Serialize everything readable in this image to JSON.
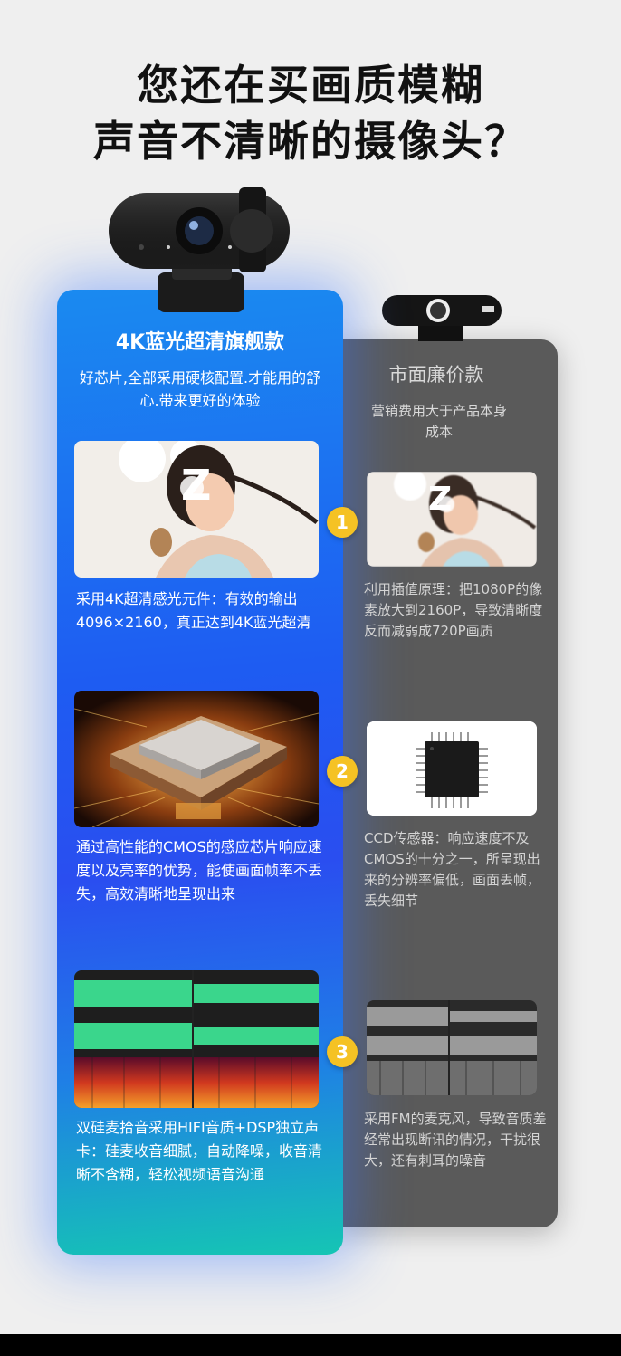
{
  "headline": {
    "line1": "您还在买画质模糊",
    "line2": "声音不清晰的摄像头？"
  },
  "premium": {
    "title": "4K蓝光超清旗舰款",
    "subtitle": "好芯片,全部采用硬核配置.才能用的舒心.带来更好的体验",
    "items": [
      {
        "badge": "1",
        "text": "采用4K超清感光元件：有效的输出4096×2160，真正达到4K蓝光超清",
        "overlay": "Z"
      },
      {
        "badge": "2",
        "text": "通过高性能的CMOS的感应芯片响应速度以及亮率的优势，能使画面帧率不丢失，高效清晰地呈现出来"
      },
      {
        "badge": "3",
        "text": "双硅麦拾音采用HIFI音质+DSP独立声卡：硅麦收音细腻，自动降噪，收音清晰不含糊，轻松视频语音沟通"
      }
    ]
  },
  "cheap": {
    "title": "市面廉价款",
    "subtitle": "营销费用大于产品本身成本",
    "items": [
      {
        "text": "利用插值原理：把1080P的像素放大到2160P，导致清晰度反而减弱成720P画质",
        "overlay": "Z"
      },
      {
        "text": "CCD传感器：响应速度不及CMOS的十分之一，所呈现出来的分辨率偏低，画面丢帧，丢失细节"
      },
      {
        "text": "采用FM的麦克风，导致音质差经常出现断讯的情况，干扰很大，还有刺耳的噪音"
      }
    ]
  },
  "colors": {
    "premium_gradient_top": "#1a8af0",
    "premium_gradient_bottom": "#15c5b4",
    "cheap_panel": "#5a5a5a",
    "badge": "#f5c224",
    "waveform_green": "#3ad68c"
  }
}
